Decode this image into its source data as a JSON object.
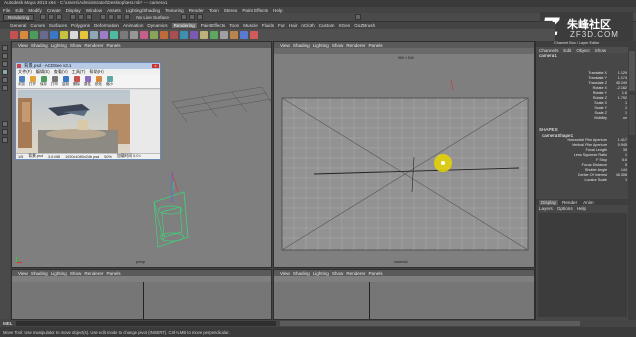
{
  "window": {
    "title": "Autodesk Maya 2013 x64 - C:\\Users\\Administrator\\Desktop\\test.mb* --- camera1"
  },
  "menubar": [
    "File",
    "Edit",
    "Modify",
    "Create",
    "Display",
    "Window",
    "Assets",
    "Lighting/Shading",
    "Texturing",
    "Render",
    "Toon",
    "Stereo",
    "Paint Effects",
    "Help"
  ],
  "statusline": {
    "mode": "Rendering",
    "live_label": "No Live Surface"
  },
  "shelf_tabs": {
    "items": [
      "General",
      "Curves",
      "Surfaces",
      "Polygons",
      "Deformation",
      "Animation",
      "Dynamics",
      "Rendering",
      "PaintEffects",
      "Toon",
      "Muscle",
      "Fluids",
      "Fur",
      "Hair",
      "nCloth",
      "Custom",
      "XGen",
      "GoZBrush"
    ],
    "active": "Rendering"
  },
  "watermark": {
    "text_cn": "朱峰社区",
    "text_en": "ZF3D.COM",
    "logo": "Z"
  },
  "viewport_menu": [
    "View",
    "Shading",
    "Lighting",
    "Show",
    "Renderer",
    "Panels"
  ],
  "viewports": {
    "top_left_label": "persp",
    "top_right_label": "camera1",
    "top_right_resolution": "960 x 540"
  },
  "acdsee": {
    "title": "背景.psd - ACDSee v3.1",
    "menu": [
      "文件(F)",
      "编辑(E)",
      "查看(V)",
      "工具(T)",
      "帮助(H)"
    ],
    "toolbar": [
      "浏览",
      "打开",
      "保存",
      "打印",
      "复制",
      "删除",
      "属性",
      "锐化",
      "缩小"
    ],
    "status": {
      "index": "1/5",
      "file": "背景.psd",
      "size": "3.6 MB",
      "dims": "1920x1080x24b psd",
      "zoom": "50%",
      "load": "加载时间 0.0 t"
    }
  },
  "right_panel": {
    "tabs": [
      "Channel Box / Layer Editor"
    ],
    "menu": [
      "Channels",
      "Edit",
      "Object",
      "Show"
    ],
    "object_name": "camera1",
    "attributes": [
      {
        "name": "Translate X",
        "value": "1.129"
      },
      {
        "name": "Translate Y",
        "value": "1.174"
      },
      {
        "name": "Translate Z",
        "value": "45.249"
      },
      {
        "name": "Rotate X",
        "value": "-2.162"
      },
      {
        "name": "Rotate Y",
        "value": "1.6"
      },
      {
        "name": "Rotate Z",
        "value": "1.792"
      },
      {
        "name": "Scale X",
        "value": "1"
      },
      {
        "name": "Scale Y",
        "value": "1"
      },
      {
        "name": "Scale Z",
        "value": "1"
      },
      {
        "name": "Visibility",
        "value": "on"
      }
    ],
    "shapes_header": "SHAPES",
    "shape_name": "cameraShape1",
    "shape_attributes": [
      {
        "name": "Horizontal Film Aperture",
        "value": "1.417"
      },
      {
        "name": "Vertical Film Aperture",
        "value": "0.945"
      },
      {
        "name": "Focal Length",
        "value": "35"
      },
      {
        "name": "Lens Squeeze Ratio",
        "value": "1"
      },
      {
        "name": "F Stop",
        "value": "5.6"
      },
      {
        "name": "Focus Distance",
        "value": "5"
      },
      {
        "name": "Shutter Angle",
        "value": "144"
      },
      {
        "name": "Center Of Interest",
        "value": "45.308"
      },
      {
        "name": "Locator Scale",
        "value": "1"
      }
    ],
    "layer_tabs": [
      "Display",
      "Render",
      "Anim"
    ],
    "layer_menu": [
      "Layers",
      "Options",
      "Help"
    ]
  },
  "bottom": {
    "mel_label": "MEL",
    "help_text": "Move Tool: Use manipulator to move object(s). Use edit mode to change pivot (INSERT). Ctrl+LMB to move perpendicular."
  },
  "colors": {
    "viewport_bg": "#7f7f7f",
    "highlight": "#e8d400",
    "camera_green": "#3fd27a"
  }
}
